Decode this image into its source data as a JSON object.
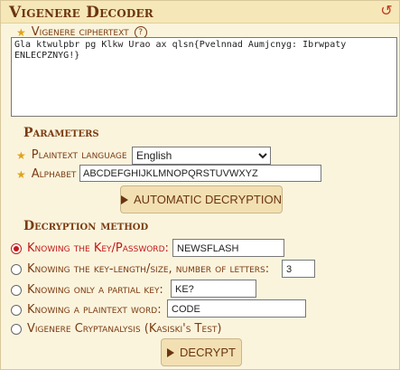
{
  "header": {
    "title": "Vigenere Decoder"
  },
  "ciphertext": {
    "label": "Vigenere ciphertext",
    "help_text": "?",
    "value": "Gla ktwulpbr pg Klkw Urao ax qlsn{Pvelnnad Aumjcnyg: Ibrwpaty ENLECPZNYG!}"
  },
  "parameters": {
    "title": "Parameters",
    "plaintext_language_label": "Plaintext language",
    "language_value": "English",
    "alphabet_label": "Alphabet",
    "alphabet_value": "ABCDEFGHIJKLMNOPQRSTUVWXYZ",
    "auto_button": "AUTOMATIC DECRYPTION"
  },
  "method": {
    "title": "Decryption method",
    "options": [
      {
        "label": "Knowing the Key/Password:",
        "value": "NEWSFLASH",
        "selected": true
      },
      {
        "label": "Knowing the key-length/size, number of letters:",
        "value": "3",
        "selected": false
      },
      {
        "label": "Knowing only a partial key:",
        "value": "KE?",
        "selected": false
      },
      {
        "label": "Knowing a plaintext word:",
        "value": "CODE",
        "selected": false
      },
      {
        "label": "Vigenere Cryptanalysis (Kasiski's Test)",
        "value": "",
        "selected": false
      }
    ],
    "decrypt_button": "DECRYPT"
  }
}
